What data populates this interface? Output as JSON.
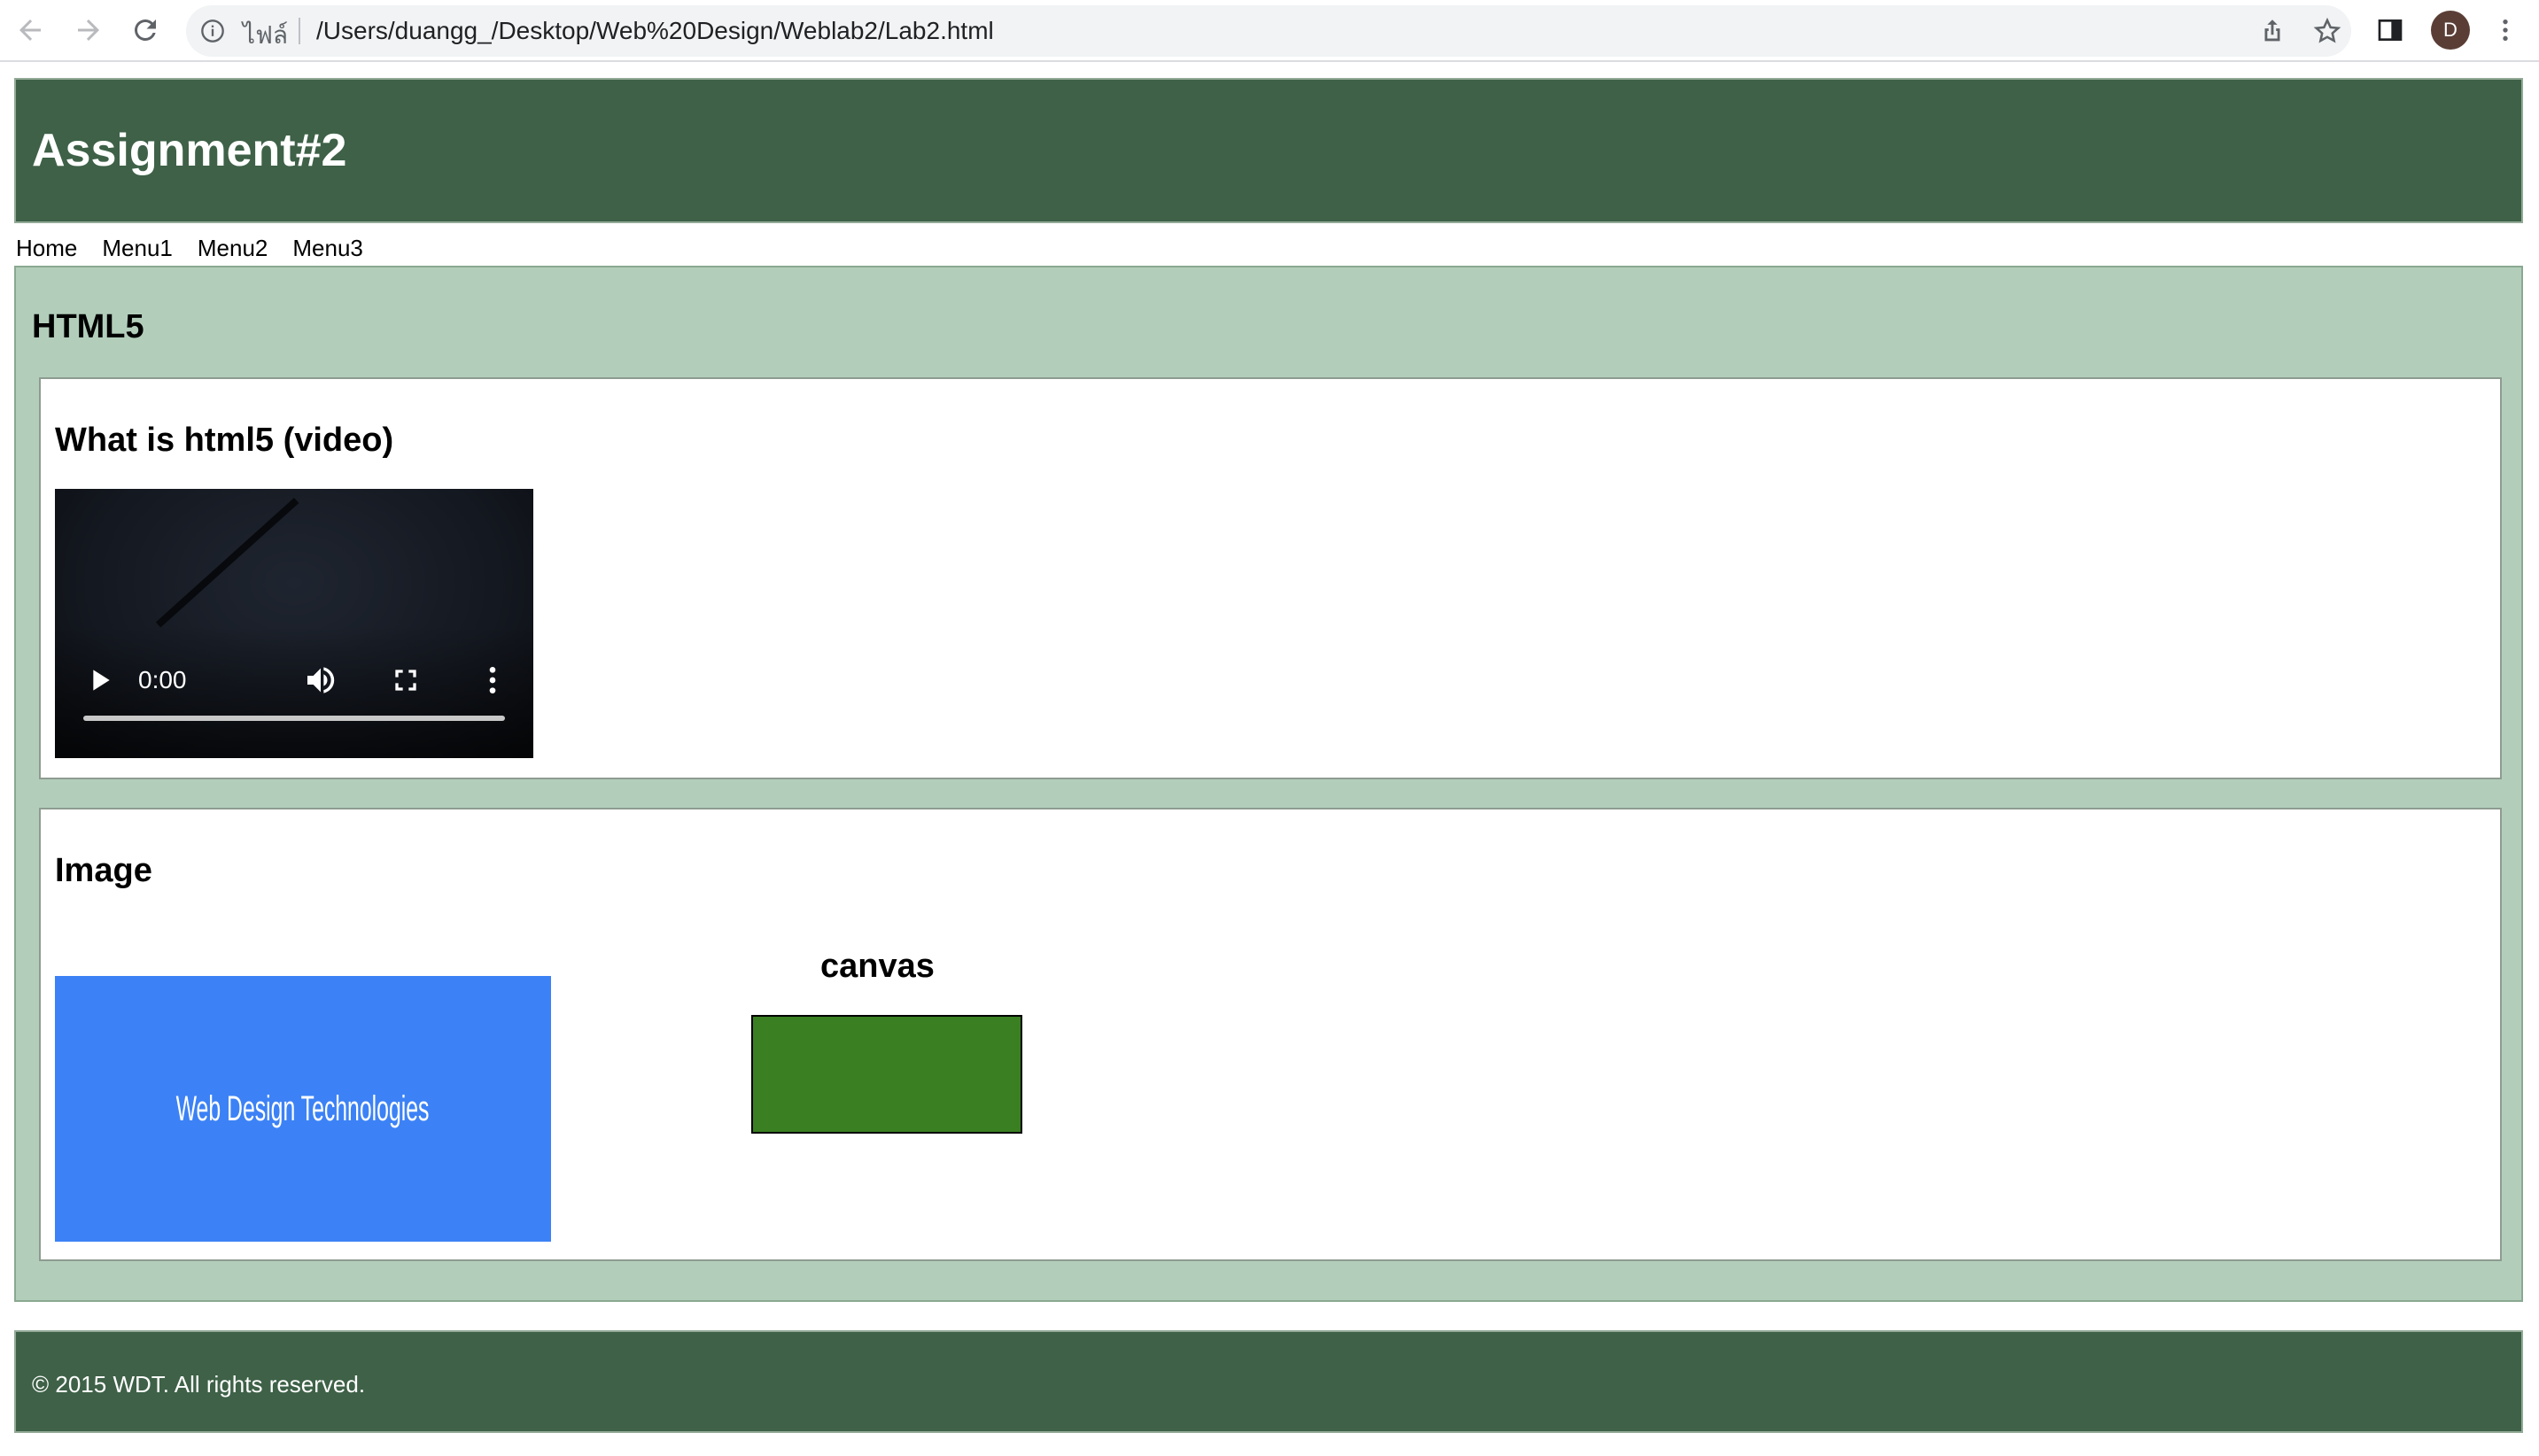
{
  "browser": {
    "scheme_label": "ไฟล์",
    "url": "/Users/duangg_/Desktop/Web%20Design/Weblab2/Lab2.html",
    "profile_initial": "D",
    "icons": [
      "back-arrow-icon",
      "forward-arrow-icon",
      "reload-icon",
      "info-icon",
      "share-icon",
      "star-icon",
      "side-panel-icon",
      "kebab-menu-icon"
    ]
  },
  "header": {
    "title": "Assignment#2",
    "bg_color": "#3e6147"
  },
  "menu": {
    "items": [
      "Home",
      "Menu1",
      "Menu2",
      "Menu3"
    ]
  },
  "main": {
    "heading": "HTML5",
    "bg_color": "#b2cebb",
    "video_section": {
      "heading": "What is html5 (video)",
      "player": {
        "time": "0:00",
        "progress": 0
      }
    },
    "image_section": {
      "heading": "Image",
      "image_text": "Web Design Technologies",
      "image_color": "#3c82f6",
      "canvas_label": "canvas",
      "canvas_fill": "#3a7f22"
    }
  },
  "footer": {
    "text": "© 2015 WDT. All rights reserved."
  }
}
